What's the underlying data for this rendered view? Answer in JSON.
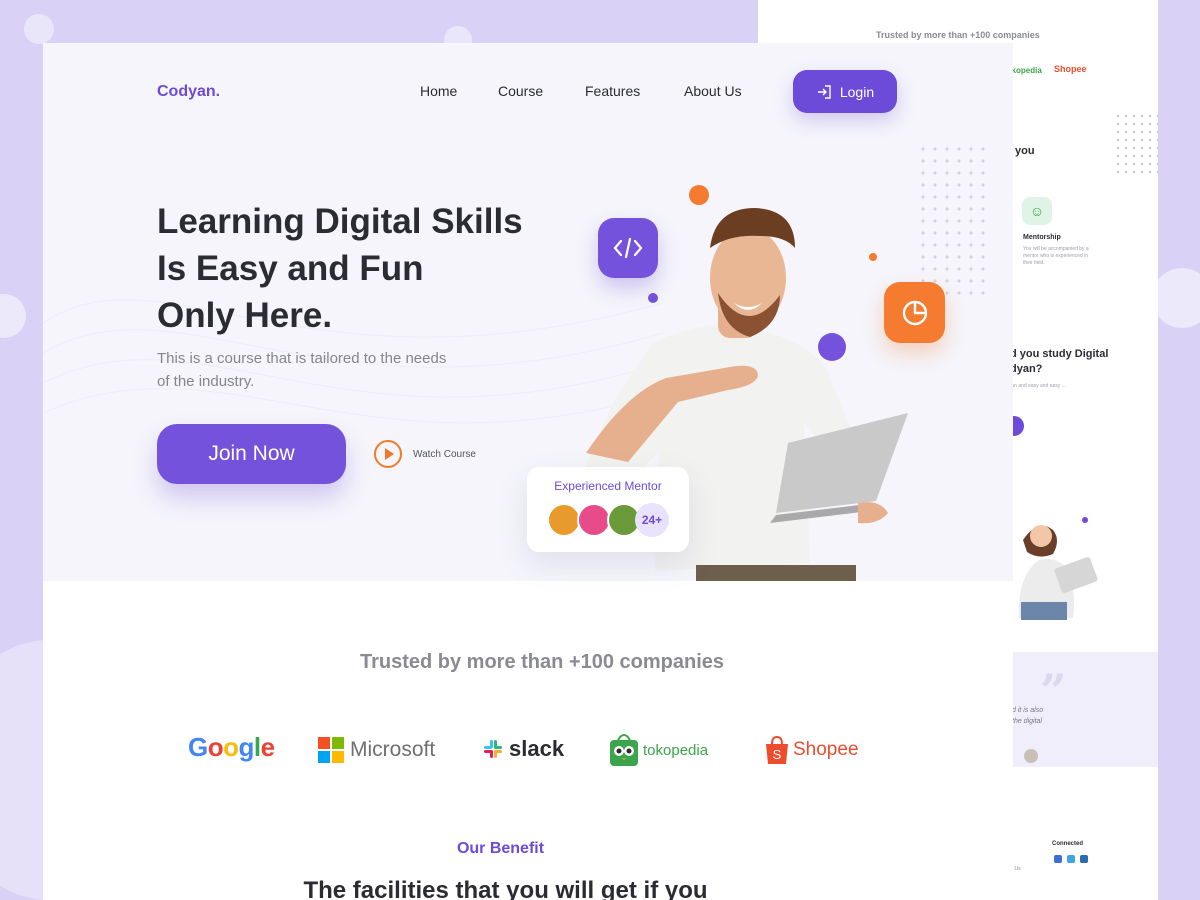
{
  "brand": {
    "name": "Codyan.",
    "accent": "#6b4bd8",
    "orange": "#f47b30"
  },
  "nav": {
    "items": [
      "Home",
      "Course",
      "Features",
      "About Us"
    ],
    "login_label": "Login"
  },
  "hero": {
    "title_line1": "Learning Digital Skills",
    "title_line2": "Is Easy and Fun",
    "title_line3": "Only Here.",
    "subtitle_line1": "This is a course that is tailored to the needs",
    "subtitle_line2": "of the industry.",
    "cta_label": "Join Now",
    "watch_label": "Watch Course",
    "mentor_card": {
      "label": "Experienced Mentor",
      "count": "24+"
    },
    "icons": [
      "code-icon",
      "pie-chart-icon",
      "play-icon",
      "login-icon"
    ]
  },
  "companies": {
    "heading": "Trusted by more than +100 companies",
    "logos": [
      "Google",
      "Microsoft",
      "slack",
      "tokopedia",
      "Shopee"
    ]
  },
  "benefit": {
    "label": "Our Benefit",
    "title": "The facilities that you will get if you"
  },
  "back_page": {
    "trusted": "Trusted by more than +100 companies",
    "tokopedia": "tokopedia",
    "shopee": "Shopee",
    "you": "you",
    "mentorship": "Mentorship",
    "mentorship_desc": "You will be accompanied by a mentor who is experienced in their field.",
    "study_line1": "d you study Digital",
    "study_line2": "dyan?",
    "study_desc": "fun and easy and easy ...",
    "quote_line1": "d it is also",
    "quote_line2": "the digital",
    "connected": "Connected",
    "with_us": "th Us"
  }
}
